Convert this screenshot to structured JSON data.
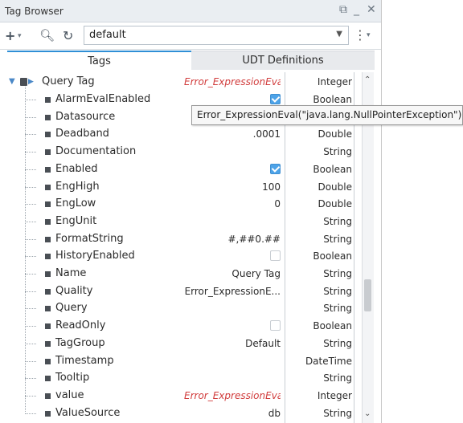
{
  "window": {
    "title": "Tag Browser",
    "restore_icon": "restore-icon",
    "minimize_icon": "minimize-icon",
    "close_icon": "close-icon"
  },
  "toolbar": {
    "add_icon": "plus-icon",
    "search_icon": "search-icon",
    "refresh_icon": "refresh-icon",
    "provider_value": "default",
    "more_icon": "kebab-icon"
  },
  "tabs": [
    {
      "label": "Tags",
      "active": true
    },
    {
      "label": "UDT Definitions",
      "active": false
    }
  ],
  "root": {
    "name": "Query Tag",
    "value": "Error_ExpressionEval",
    "type": "Integer"
  },
  "rows": [
    {
      "name": "AlarmEvalEnabled",
      "value": "",
      "checkbox": "on",
      "type": "Boolean"
    },
    {
      "name": "Datasource",
      "value": "",
      "type": "String"
    },
    {
      "name": "Deadband",
      "value": ".0001",
      "type": "Double"
    },
    {
      "name": "Documentation",
      "value": "",
      "type": "String"
    },
    {
      "name": "Enabled",
      "value": "",
      "checkbox": "on",
      "type": "Boolean"
    },
    {
      "name": "EngHigh",
      "value": "100",
      "type": "Double"
    },
    {
      "name": "EngLow",
      "value": "0",
      "type": "Double"
    },
    {
      "name": "EngUnit",
      "value": "",
      "type": "String"
    },
    {
      "name": "FormatString",
      "value": "#,##0.##",
      "type": "String"
    },
    {
      "name": "HistoryEnabled",
      "value": "",
      "checkbox": "off",
      "type": "Boolean"
    },
    {
      "name": "Name",
      "value": "Query Tag",
      "type": "String"
    },
    {
      "name": "Quality",
      "value": "Error_ExpressionE...",
      "type": "String"
    },
    {
      "name": "Query",
      "value": "",
      "type": "String"
    },
    {
      "name": "ReadOnly",
      "value": "",
      "checkbox": "off",
      "type": "Boolean"
    },
    {
      "name": "TagGroup",
      "value": "Default",
      "type": "String"
    },
    {
      "name": "Timestamp",
      "value": "",
      "type": "DateTime"
    },
    {
      "name": "Tooltip",
      "value": "",
      "type": "String"
    },
    {
      "name": "value",
      "value": "Error_ExpressionEval",
      "error": true,
      "type": "Integer"
    },
    {
      "name": "ValueSource",
      "value": "db",
      "type": "String"
    }
  ],
  "tooltip": {
    "text": "Error_ExpressionEval(\"java.lang.NullPointerException\")"
  }
}
